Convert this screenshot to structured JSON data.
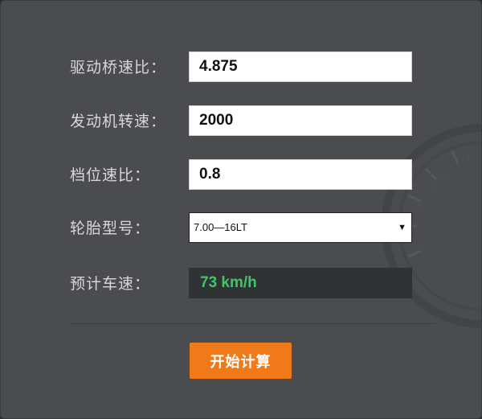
{
  "form": {
    "axle_ratio": {
      "label": "驱动桥速比：",
      "value": "4.875"
    },
    "engine_speed": {
      "label": "发动机转速：",
      "value": "2000"
    },
    "gear_ratio": {
      "label": "档位速比：",
      "value": "0.8"
    },
    "tire_model": {
      "label": "轮胎型号：",
      "selected": "7.00—16LT"
    },
    "estimated_speed": {
      "label": "预计车速：",
      "value": "73 km/h"
    }
  },
  "calculate_button": {
    "label": "开始计算"
  },
  "colors": {
    "panel": "#4a4c50",
    "accent_button": "#f07a1a",
    "result_text": "#3ec66a",
    "label_text": "#d8d8d8"
  },
  "icons": {
    "background_decoration": "speedometer-gauge"
  }
}
